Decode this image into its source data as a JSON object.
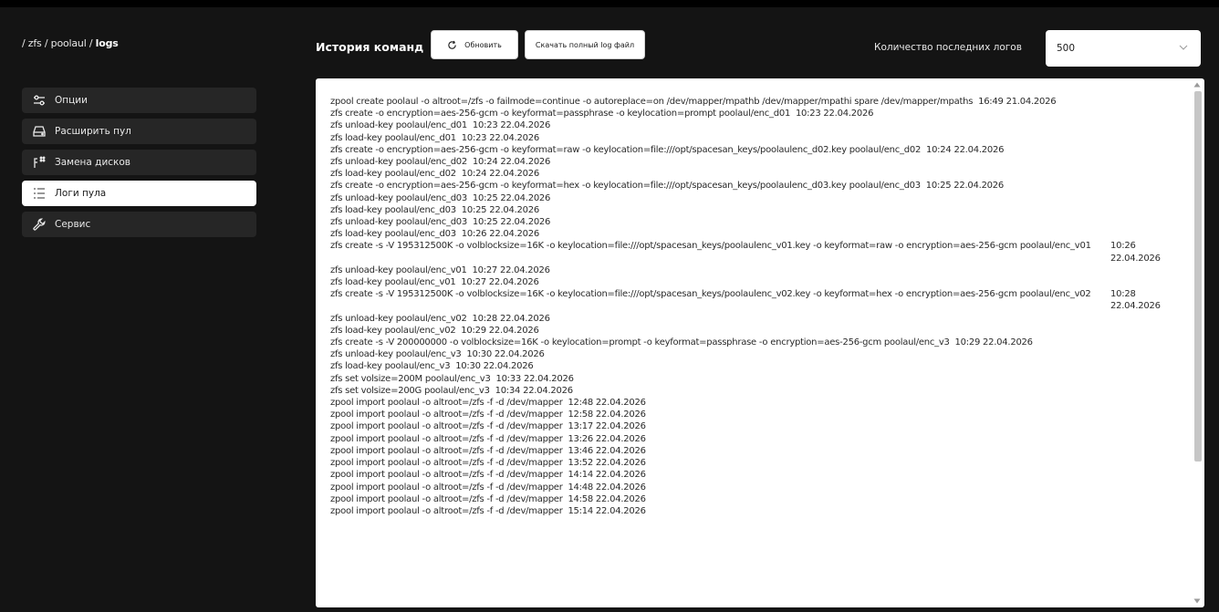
{
  "breadcrumb": {
    "path": "/ zfs / poolaul / ",
    "current": "logs"
  },
  "sidebar": {
    "items": [
      {
        "label": "Опции",
        "icon": "sliders-icon",
        "active": false
      },
      {
        "label": "Расширить пул",
        "icon": "drive-icon",
        "active": false
      },
      {
        "label": "Замена дисков",
        "icon": "swap-disk-icon",
        "active": false
      },
      {
        "label": "Логи пула",
        "icon": "list-icon",
        "active": true
      },
      {
        "label": "Сервис",
        "icon": "wrench-icon",
        "active": false
      }
    ]
  },
  "header": {
    "title": "История команд",
    "refresh_label": "Обновить",
    "download_label": "Скачать полный log файл",
    "count_label": "Количество последних логов",
    "count_value": "500"
  },
  "logs": [
    {
      "cmd": "zpool create poolaul -o altroot=/zfs -o failmode=continue -o autoreplace=on /dev/mapper/mpathb /dev/mapper/mpathi spare /dev/mapper/mpaths",
      "time": "16:49 21.04.2026"
    },
    {
      "cmd": "zfs create -o encryption=aes-256-gcm -o keyformat=passphrase -o keylocation=prompt poolaul/enc_d01",
      "time": "10:23 22.04.2026"
    },
    {
      "cmd": "zfs unload-key poolaul/enc_d01",
      "time": "10:23 22.04.2026"
    },
    {
      "cmd": "zfs load-key poolaul/enc_d01",
      "time": "10:23 22.04.2026"
    },
    {
      "cmd": "zfs create -o encryption=aes-256-gcm -o keyformat=raw -o keylocation=file:///opt/spacesan_keys/poolaulenc_d02.key poolaul/enc_d02",
      "time": "10:24 22.04.2026"
    },
    {
      "cmd": "zfs unload-key poolaul/enc_d02",
      "time": "10:24 22.04.2026"
    },
    {
      "cmd": "zfs load-key poolaul/enc_d02",
      "time": "10:24 22.04.2026"
    },
    {
      "cmd": "zfs create -o encryption=aes-256-gcm -o keyformat=hex -o keylocation=file:///opt/spacesan_keys/poolaulenc_d03.key poolaul/enc_d03",
      "time": "10:25 22.04.2026"
    },
    {
      "cmd": "zfs unload-key poolaul/enc_d03",
      "time": "10:25 22.04.2026"
    },
    {
      "cmd": "zfs load-key poolaul/enc_d03",
      "time": "10:25 22.04.2026"
    },
    {
      "cmd": "zfs unload-key poolaul/enc_d03",
      "time": "10:25 22.04.2026"
    },
    {
      "cmd": "zfs load-key poolaul/enc_d03",
      "time": "10:26 22.04.2026"
    },
    {
      "cmd": "zfs create -s -V 195312500K -o volblocksize=16K -o keylocation=file:///opt/spacesan_keys/poolaulenc_v01.key -o keyformat=raw -o encryption=aes-256-gcm poolaul/enc_v01",
      "time": "10:26 22.04.2026",
      "wrap": true
    },
    {
      "cmd": "zfs unload-key poolaul/enc_v01",
      "time": "10:27 22.04.2026"
    },
    {
      "cmd": "zfs load-key poolaul/enc_v01",
      "time": "10:27 22.04.2026"
    },
    {
      "cmd": "zfs create -s -V 195312500K -o volblocksize=16K -o keylocation=file:///opt/spacesan_keys/poolaulenc_v02.key -o keyformat=hex -o encryption=aes-256-gcm poolaul/enc_v02",
      "time": "10:28 22.04.2026",
      "wrap": true
    },
    {
      "cmd": "zfs unload-key poolaul/enc_v02",
      "time": "10:28 22.04.2026"
    },
    {
      "cmd": "zfs load-key poolaul/enc_v02",
      "time": "10:29 22.04.2026"
    },
    {
      "cmd": "zfs create -s -V 200000000 -o volblocksize=16K -o keylocation=prompt -o keyformat=passphrase -o encryption=aes-256-gcm poolaul/enc_v3",
      "time": "10:29 22.04.2026"
    },
    {
      "cmd": "zfs unload-key poolaul/enc_v3",
      "time": "10:30 22.04.2026"
    },
    {
      "cmd": "zfs load-key poolaul/enc_v3",
      "time": "10:30 22.04.2026"
    },
    {
      "cmd": "zfs set volsize=200M poolaul/enc_v3",
      "time": "10:33 22.04.2026"
    },
    {
      "cmd": "zfs set volsize=200G poolaul/enc_v3",
      "time": "10:34 22.04.2026"
    },
    {
      "cmd": "zpool import poolaul -o altroot=/zfs -f -d /dev/mapper",
      "time": "12:48 22.04.2026"
    },
    {
      "cmd": "zpool import poolaul -o altroot=/zfs -f -d /dev/mapper",
      "time": "12:58 22.04.2026"
    },
    {
      "cmd": "zpool import poolaul -o altroot=/zfs -f -d /dev/mapper",
      "time": "13:17 22.04.2026"
    },
    {
      "cmd": "zpool import poolaul -o altroot=/zfs -f -d /dev/mapper",
      "time": "13:26 22.04.2026"
    },
    {
      "cmd": "zpool import poolaul -o altroot=/zfs -f -d /dev/mapper",
      "time": "13:46 22.04.2026"
    },
    {
      "cmd": "zpool import poolaul -o altroot=/zfs -f -d /dev/mapper",
      "time": "13:52 22.04.2026"
    },
    {
      "cmd": "zpool import poolaul -o altroot=/zfs -f -d /dev/mapper",
      "time": "14:14 22.04.2026"
    },
    {
      "cmd": "zpool import poolaul -o altroot=/zfs -f -d /dev/mapper",
      "time": "14:48 22.04.2026"
    },
    {
      "cmd": "zpool import poolaul -o altroot=/zfs -f -d /dev/mapper",
      "time": "14:58 22.04.2026"
    },
    {
      "cmd": "zpool import poolaul -o altroot=/zfs -f -d /dev/mapper",
      "time": "15:14 22.04.2026"
    }
  ]
}
